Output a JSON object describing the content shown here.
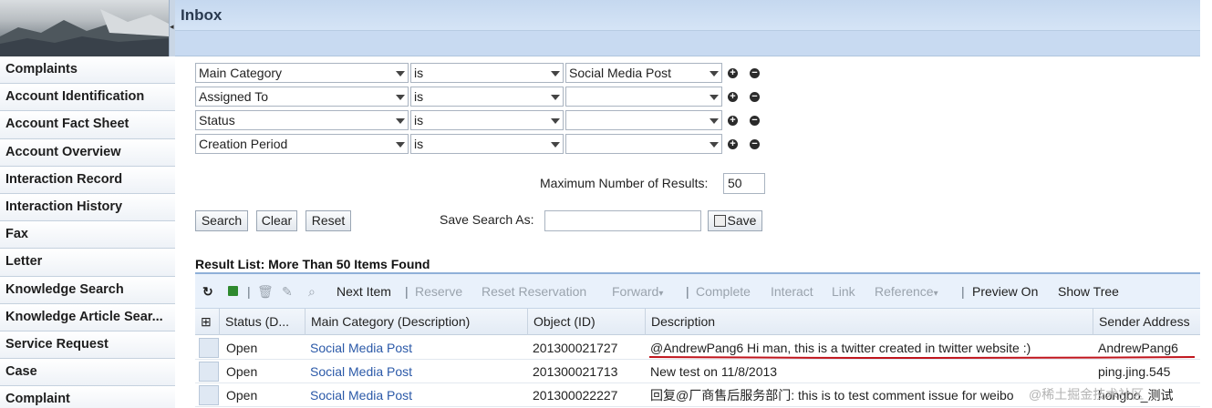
{
  "header": {
    "title": "Inbox"
  },
  "sidebar": {
    "items": [
      {
        "label": "Complaints"
      },
      {
        "label": "Account Identification"
      },
      {
        "label": "Account Fact Sheet"
      },
      {
        "label": "Account Overview"
      },
      {
        "label": "Interaction Record"
      },
      {
        "label": "Interaction History"
      },
      {
        "label": "Fax"
      },
      {
        "label": "Letter"
      },
      {
        "label": "Knowledge Search"
      },
      {
        "label": "Knowledge Article Sear..."
      },
      {
        "label": "Service Request"
      },
      {
        "label": "Case"
      },
      {
        "label": "Complaint"
      }
    ]
  },
  "criteria": [
    {
      "field": "Main Category",
      "operator": "is",
      "value": "Social Media Post"
    },
    {
      "field": "Assigned To",
      "operator": "is",
      "value": ""
    },
    {
      "field": "Status",
      "operator": "is",
      "value": ""
    },
    {
      "field": "Creation Period",
      "operator": "is",
      "value": ""
    }
  ],
  "max_results": {
    "label": "Maximum Number of Results:",
    "value": "50"
  },
  "buttons": {
    "search": "Search",
    "clear": "Clear",
    "reset": "Reset",
    "save": "Save"
  },
  "save_search": {
    "label": "Save Search As:",
    "value": ""
  },
  "result_title": "Result List: More Than 50 Items Found",
  "toolbar": {
    "next_item": "Next Item",
    "reserve": "Reserve",
    "reset_reservation": "Reset Reservation",
    "forward": "Forward",
    "complete": "Complete",
    "interact": "Interact",
    "link": "Link",
    "reference": "Reference",
    "preview_on": "Preview On",
    "show_tree": "Show Tree"
  },
  "table": {
    "columns": [
      "Status (D...",
      "Main Category (Description)",
      "Object (ID)",
      "Description",
      "Sender Address"
    ],
    "rows": [
      [
        "Open",
        "Social Media Post",
        "201300021727",
        "@AndrewPang6 Hi man, this is a twitter created in twitter website :)",
        "AndrewPang6"
      ],
      [
        "Open",
        "Social Media Post",
        "201300021713",
        "New test on 11/8/2013",
        "ping.jing.545"
      ],
      [
        "Open",
        "Social Media Post",
        "201300022227",
        "回复@厂商售后服务部门: this is to test comment issue for weibo",
        "hongbo_测试"
      ]
    ]
  },
  "watermark": "@稀土掘金技术社区",
  "colors": {
    "accent": "#8fb0d8",
    "link": "#2b59a8",
    "highlight_underline": "#c0141c"
  }
}
